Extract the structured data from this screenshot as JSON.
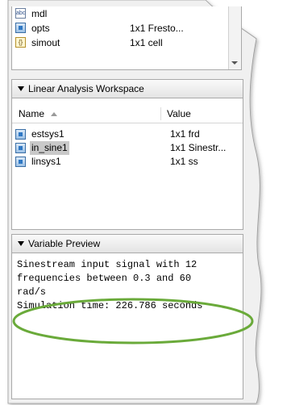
{
  "workspace": {
    "rows": [
      {
        "icon": "abc-icon",
        "name": "mdl",
        "value": ""
      },
      {
        "icon": "object-icon",
        "name": "opts",
        "value": "1x1 Fresto..."
      },
      {
        "icon": "cell-icon",
        "name": "simout",
        "value": "1x1 cell"
      }
    ]
  },
  "linear_analysis": {
    "title": "Linear Analysis Workspace",
    "columns": {
      "name": "Name",
      "value": "Value"
    },
    "rows": [
      {
        "name": "estsys1",
        "value": "1x1 frd",
        "selected": false
      },
      {
        "name": "in_sine1",
        "value": "1x1 Sinestr...",
        "selected": true
      },
      {
        "name": "linsys1",
        "value": "1x1 ss",
        "selected": false
      }
    ]
  },
  "variable_preview": {
    "title": "Variable Preview",
    "text": "Sinestream input signal with 12\nfrequencies between 0.3 and 60\nrad/s\nSimulation time: 226.786 seconds"
  },
  "colors": {
    "highlight_ellipse": "#6aaa3a",
    "selection": "#c9c9c9"
  }
}
